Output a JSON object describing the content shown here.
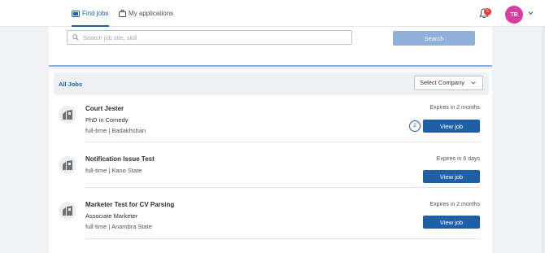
{
  "nav": {
    "find_jobs": "Find jobs",
    "my_applications": "My applications",
    "notification_count": "6",
    "avatar_initials": "TB"
  },
  "search": {
    "placeholder": "Search job title, skill",
    "value": "",
    "button_label": "Search"
  },
  "list": {
    "heading": "All Jobs",
    "company_select": "Select Company"
  },
  "jobs": [
    {
      "title": "Court Jester",
      "subtitle": "PhD in Comedy",
      "meta": "full-time | Badakhshan",
      "expiry": "Expires in 2 months",
      "button": "View job",
      "marker": "2"
    },
    {
      "title": "Notification Issue Test",
      "subtitle": "",
      "meta": "full-time | Kano State",
      "expiry": "Expires in 6 days",
      "button": "View job"
    },
    {
      "title": "Marketer Test for CV Parsing",
      "subtitle": "Associate Marketer",
      "meta": "full-time | Anambra State",
      "expiry": "Expires in 2 months",
      "button": "View job"
    }
  ],
  "colors": {
    "primary": "#1f5fa8",
    "search_button": "#8fb1d9",
    "avatar": "#d63fa0",
    "badge": "#e53935"
  }
}
